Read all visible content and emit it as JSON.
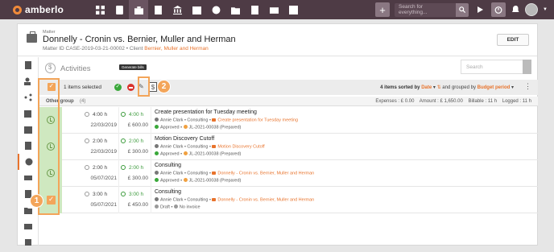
{
  "app": {
    "logo_text": "amberlo"
  },
  "topnav": {
    "add_label": "+",
    "search_placeholder": "Search for everything...",
    "icons": [
      "dashboard-icon",
      "contacts-icon",
      "matters-icon",
      "invoices-icon",
      "bank-icon",
      "calendar-icon",
      "time-icon",
      "folder-icon",
      "video-icon",
      "mail-icon",
      "chart-icon"
    ]
  },
  "matter": {
    "label": "Matter",
    "title": "Donnelly - Cronin vs. Bernier, Muller and Herman",
    "id_label": "Matter ID",
    "id_value": "CASE-2019-03-21-00002",
    "client_label": "Client",
    "client_name": "Bernier, Muller and Herman",
    "edit_label": "EDIT"
  },
  "activities": {
    "title": "Activities",
    "search_placeholder": "Search"
  },
  "toolbar": {
    "selected_text": "1 items selected",
    "tooltip": "Generate bills",
    "sort_prefix": "4 items sorted by",
    "sort_field": "Date",
    "group_prefix": "and grouped by",
    "group_field": "Budget period"
  },
  "group": {
    "name": "Other group",
    "count": "(4)",
    "expenses": "Expenses : £ 0.00",
    "amount": "Amount : £ 1,650.00",
    "billable": "Billable : 11 h",
    "logged": "Logged : 11 h"
  },
  "rows": [
    {
      "time": "4:00 h",
      "date": "22/03/2019",
      "billed_time": "4:00 h",
      "amount": "£ 600.00",
      "title": "Create presentation for Tuesday meeting",
      "user": "Annie Clark",
      "category": "Consulting",
      "link": "Create presentation for Tuesday meeting",
      "status": "Approved",
      "invoice": "JL-2021-00038 (Prepared)",
      "selected": false
    },
    {
      "time": "2:00 h",
      "date": "22/03/2019",
      "billed_time": "2:00 h",
      "amount": "£ 300.00",
      "title": "Motion Discovery Cutoff",
      "user": "Annie Clark",
      "category": "Consulting",
      "link": "Motion Discovery Cutoff",
      "status": "Approved",
      "invoice": "JL-2021-00038 (Prepared)",
      "selected": false
    },
    {
      "time": "2:00 h",
      "date": "05/07/2021",
      "billed_time": "2:00 h",
      "amount": "£ 300.00",
      "title": "Consulting",
      "user": "Annie Clark",
      "category": "Consulting",
      "link": "Donnelly - Cronin vs. Bernier, Muller and Herman",
      "status": "Approved",
      "invoice": "JL-2021-00038 (Prepared)",
      "selected": false
    },
    {
      "time": "3:00 h",
      "date": "05/07/2021",
      "billed_time": "3:00 h",
      "amount": "£ 450.00",
      "title": "Consulting",
      "user": "Annie Clark",
      "category": "Consulting",
      "link": "Donnelly - Cronin vs. Bernier, Muller and Herman",
      "status": "Draft",
      "invoice": "No invoice",
      "selected": true
    }
  ],
  "annotations": {
    "badge_1": "1",
    "badge_2": "2"
  },
  "colors": {
    "accent": "#e8732c",
    "nav_bg": "#4e3b45",
    "highlight": "#f3a55a",
    "row_strip": "#cfe8c0"
  }
}
